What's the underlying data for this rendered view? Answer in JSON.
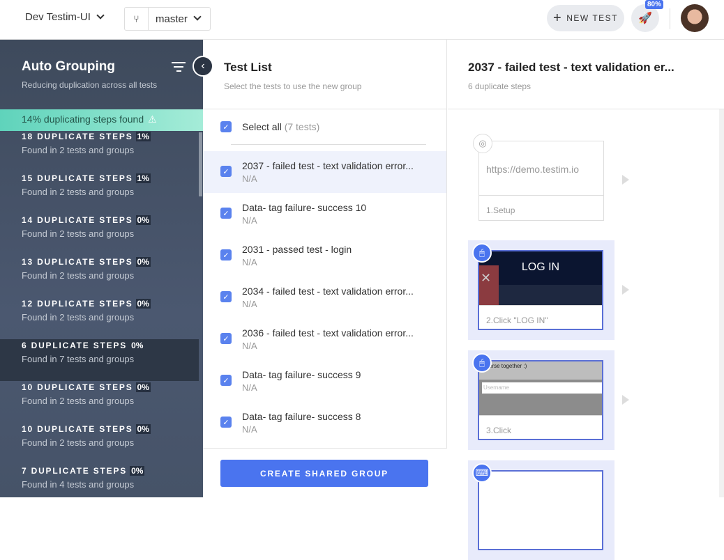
{
  "topbar": {
    "project": "Dev Testim-UI",
    "branch": "master",
    "new_test": "NEW TEST",
    "notif_badge": "80%"
  },
  "sidebar": {
    "title": "Auto Grouping",
    "subtitle": "Reducing duplication across all tests",
    "banner": "14% duplicating steps found",
    "items": [
      {
        "title": "18 DUPLICATE STEPS",
        "pct": "1%",
        "sub": "Found in 2 tests and groups"
      },
      {
        "title": "15 DUPLICATE STEPS",
        "pct": "1%",
        "sub": "Found in 2 tests and groups"
      },
      {
        "title": "14 DUPLICATE STEPS",
        "pct": "0%",
        "sub": "Found in 2 tests and groups"
      },
      {
        "title": "13 DUPLICATE STEPS",
        "pct": "0%",
        "sub": "Found in 2 tests and groups"
      },
      {
        "title": "12 DUPLICATE STEPS",
        "pct": "0%",
        "sub": "Found in 2 tests and groups"
      },
      {
        "title": "6 DUPLICATE STEPS",
        "pct": "0%",
        "sub": "Found in 7 tests and groups"
      },
      {
        "title": "10 DUPLICATE STEPS",
        "pct": "0%",
        "sub": "Found in 2 tests and groups"
      },
      {
        "title": "10 DUPLICATE STEPS",
        "pct": "0%",
        "sub": "Found in 2 tests and groups"
      },
      {
        "title": "7 DUPLICATE STEPS",
        "pct": "0%",
        "sub": "Found in 4 tests and groups"
      }
    ]
  },
  "test_list": {
    "title": "Test List",
    "subtitle": "Select the tests to use the new group",
    "select_all": "Select all",
    "select_count": "(7 tests)",
    "rows": [
      {
        "name": "2037 - failed test - text validation error...",
        "value": "N/A"
      },
      {
        "name": "Data- tag failure- success 10",
        "value": "N/A"
      },
      {
        "name": "2031 - passed test - login",
        "value": "N/A"
      },
      {
        "name": "2034 - failed test - text validation error...",
        "value": "N/A"
      },
      {
        "name": "2036 - failed test - text validation error...",
        "value": "N/A"
      },
      {
        "name": "Data- tag failure- success 9",
        "value": "N/A"
      },
      {
        "name": "Data- tag failure- success 8",
        "value": "N/A"
      }
    ],
    "create": "CREATE SHARED GROUP"
  },
  "detail": {
    "title": "2037 - failed test - text validation er...",
    "subtitle": "6 duplicate steps",
    "steps": [
      {
        "label": "1.Setup",
        "url": "https://demo.testim.io"
      },
      {
        "label": "2.Click \"LOG IN\"",
        "shot_text": "LOG IN"
      },
      {
        "label": "3.Click",
        "shot_text": "erse together :)",
        "field": "Username"
      }
    ]
  }
}
